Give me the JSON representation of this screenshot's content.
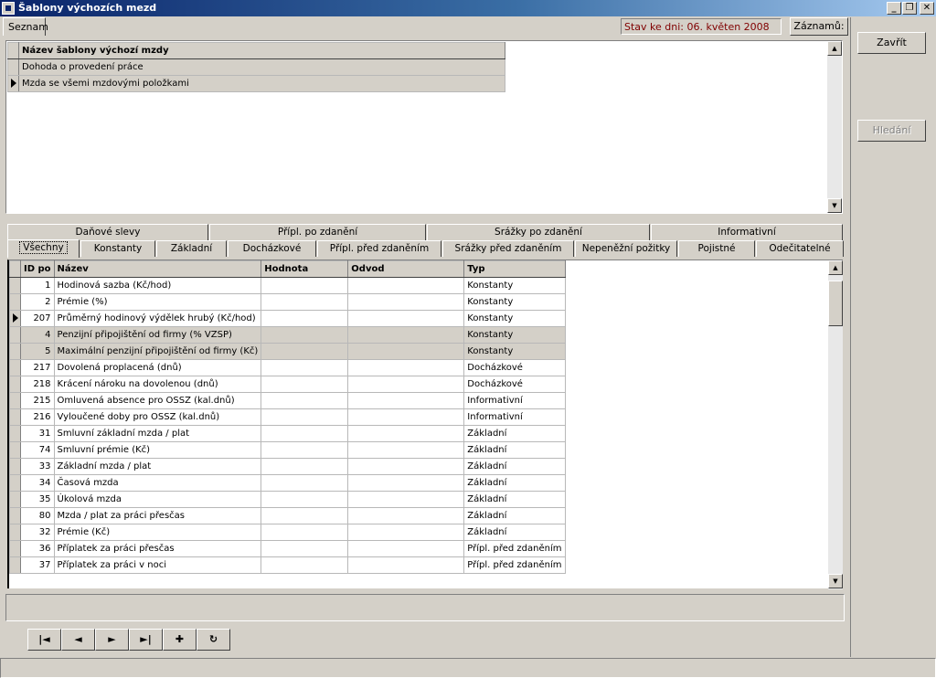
{
  "window": {
    "title": "Šablony výchozích mezd",
    "min_label": "_",
    "max_label": "❐",
    "close_label": "✕"
  },
  "toolbar": {
    "seznam_tab": "Seznam",
    "status_text": "Stav ke dni: 06. květen 2008",
    "zaznamu_label": "Záznamů:"
  },
  "side": {
    "zavrit_label": "Zavřít",
    "hledani_label": "Hledání"
  },
  "templates": {
    "header": "Název šablony výchozí mzdy",
    "rows": [
      {
        "name": "Dohoda o provedení práce"
      },
      {
        "name": "Mzda se všemi mzdovými položkami"
      }
    ],
    "current_row": 1
  },
  "tabs": {
    "row1": [
      "Daňové slevy",
      "Přípl. po zdanění",
      "Srážky po zdanění",
      "Informativní"
    ],
    "row2": [
      "Všechny",
      "Konstanty",
      "Základní",
      "Docházkové",
      "Přípl. před zdaněním",
      "Srážky před zdaněním",
      "Nepeněžní požitky",
      "Pojistné",
      "Odečitatelné"
    ],
    "active": "Všechny"
  },
  "items": {
    "columns": [
      "ID po",
      "Název",
      "Hodnota",
      "Odvod",
      "Typ"
    ],
    "rows": [
      {
        "id": "1",
        "name": "Hodinová sazba (Kč/hod)",
        "value": "",
        "odvod": "",
        "typ": "Konstanty"
      },
      {
        "id": "2",
        "name": "Prémie (%)",
        "value": "",
        "odvod": "",
        "typ": "Konstanty"
      },
      {
        "id": "207",
        "name": "Průměrný hodinový výdělek hrubý (Kč/hod)",
        "value": "",
        "odvod": "",
        "typ": "Konstanty"
      },
      {
        "id": "4",
        "name": "Penzijní připojištění od firmy (% VZSP)",
        "value": "",
        "odvod": "",
        "typ": "Konstanty"
      },
      {
        "id": "5",
        "name": "Maximální penzijní připojištění od firmy (Kč)",
        "value": "",
        "odvod": "",
        "typ": "Konstanty"
      },
      {
        "id": "217",
        "name": "Dovolená proplacená (dnů)",
        "value": "",
        "odvod": "",
        "typ": "Docházkové"
      },
      {
        "id": "218",
        "name": "Krácení nároku na dovolenou (dnů)",
        "value": "",
        "odvod": "",
        "typ": "Docházkové"
      },
      {
        "id": "215",
        "name": "Omluvená absence pro OSSZ (kal.dnů)",
        "value": "",
        "odvod": "",
        "typ": "Informativní"
      },
      {
        "id": "216",
        "name": "Vyloučené doby pro OSSZ (kal.dnů)",
        "value": "",
        "odvod": "",
        "typ": "Informativní"
      },
      {
        "id": "31",
        "name": "Smluvní základní mzda / plat",
        "value": "",
        "odvod": "",
        "typ": "Základní"
      },
      {
        "id": "74",
        "name": "Smluvní prémie (Kč)",
        "value": "",
        "odvod": "",
        "typ": "Základní"
      },
      {
        "id": "33",
        "name": "Základní mzda / plat",
        "value": "",
        "odvod": "",
        "typ": "Základní"
      },
      {
        "id": "34",
        "name": "Časová mzda",
        "value": "",
        "odvod": "",
        "typ": "Základní"
      },
      {
        "id": "35",
        "name": "Úkolová mzda",
        "value": "",
        "odvod": "",
        "typ": "Základní"
      },
      {
        "id": "80",
        "name": "Mzda / plat za práci přesčas",
        "value": "",
        "odvod": "",
        "typ": "Základní"
      },
      {
        "id": "32",
        "name": "Prémie (Kč)",
        "value": "",
        "odvod": "",
        "typ": "Základní"
      },
      {
        "id": "36",
        "name": "Příplatek za práci přesčas",
        "value": "",
        "odvod": "",
        "typ": "Přípl. před zdaněním"
      },
      {
        "id": "37",
        "name": "Příplatek za práci v noci",
        "value": "",
        "odvod": "",
        "typ": "Přípl. před zdaněním"
      }
    ],
    "current_row": 2,
    "selected_rows": [
      3,
      4
    ]
  },
  "navigator": {
    "first": "|◄",
    "prev": "◄",
    "next": "►",
    "last": "►|",
    "add": "✚",
    "refresh": "↻"
  }
}
